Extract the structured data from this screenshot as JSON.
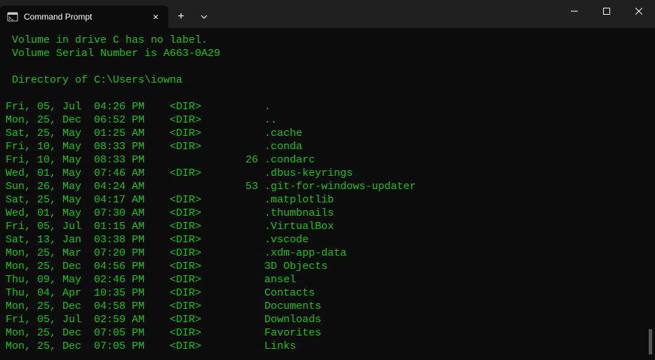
{
  "tab": {
    "title": "Command Prompt"
  },
  "terminal": {
    "vol_line": " Volume in drive C has no label.",
    "serial_line": " Volume Serial Number is A663-0A29",
    "dir_line": " Directory of C:\\Users\\iowna",
    "entries": [
      {
        "date": "Fri, 05, Jul",
        "time": "04:26 PM",
        "type": "<DIR>",
        "size": "",
        "name": "."
      },
      {
        "date": "Mon, 25, Dec",
        "time": "06:52 PM",
        "type": "<DIR>",
        "size": "",
        "name": ".."
      },
      {
        "date": "Sat, 25, May",
        "time": "01:25 AM",
        "type": "<DIR>",
        "size": "",
        "name": ".cache"
      },
      {
        "date": "Fri, 10, May",
        "time": "08:33 PM",
        "type": "<DIR>",
        "size": "",
        "name": ".conda"
      },
      {
        "date": "Fri, 10, May",
        "time": "08:33 PM",
        "type": "",
        "size": "26",
        "name": ".condarc"
      },
      {
        "date": "Wed, 01, May",
        "time": "07:46 AM",
        "type": "<DIR>",
        "size": "",
        "name": ".dbus-keyrings"
      },
      {
        "date": "Sun, 26, May",
        "time": "04:24 AM",
        "type": "",
        "size": "53",
        "name": ".git-for-windows-updater"
      },
      {
        "date": "Sat, 25, May",
        "time": "04:17 AM",
        "type": "<DIR>",
        "size": "",
        "name": ".matplotlib"
      },
      {
        "date": "Wed, 01, May",
        "time": "07:30 AM",
        "type": "<DIR>",
        "size": "",
        "name": ".thumbnails"
      },
      {
        "date": "Fri, 05, Jul",
        "time": "01:15 AM",
        "type": "<DIR>",
        "size": "",
        "name": ".VirtualBox"
      },
      {
        "date": "Sat, 13, Jan",
        "time": "03:38 PM",
        "type": "<DIR>",
        "size": "",
        "name": ".vscode"
      },
      {
        "date": "Mon, 25, Mar",
        "time": "07:20 PM",
        "type": "<DIR>",
        "size": "",
        "name": ".xdm-app-data"
      },
      {
        "date": "Mon, 25, Dec",
        "time": "04:56 PM",
        "type": "<DIR>",
        "size": "",
        "name": "3D Objects"
      },
      {
        "date": "Thu, 09, May",
        "time": "02:46 PM",
        "type": "<DIR>",
        "size": "",
        "name": "ansel"
      },
      {
        "date": "Thu, 04, Apr",
        "time": "10:35 PM",
        "type": "<DIR>",
        "size": "",
        "name": "Contacts"
      },
      {
        "date": "Mon, 25, Dec",
        "time": "04:58 PM",
        "type": "<DIR>",
        "size": "",
        "name": "Documents"
      },
      {
        "date": "Fri, 05, Jul",
        "time": "02:59 AM",
        "type": "<DIR>",
        "size": "",
        "name": "Downloads"
      },
      {
        "date": "Mon, 25, Dec",
        "time": "07:05 PM",
        "type": "<DIR>",
        "size": "",
        "name": "Favorites"
      },
      {
        "date": "Mon, 25, Dec",
        "time": "07:05 PM",
        "type": "<DIR>",
        "size": "",
        "name": "Links"
      }
    ]
  }
}
